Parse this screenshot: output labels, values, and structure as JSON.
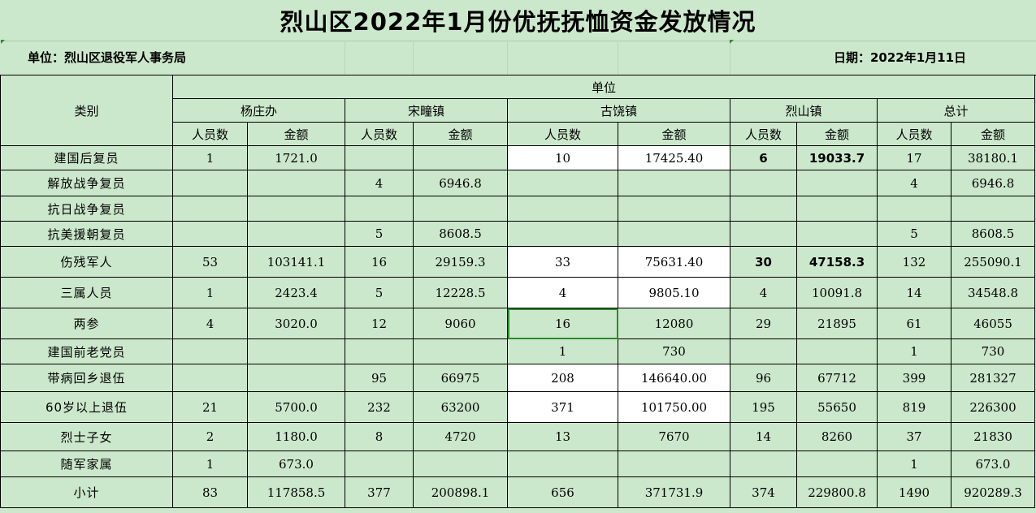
{
  "title": "烈山区2022年1月份优抚抚恤资金发放情况",
  "unit_label": "单位：烈山区退役军人事务局",
  "date_label": "日期：2022年1月11日",
  "header": {
    "category": "类别",
    "unit": "单位",
    "groups": [
      "杨庄办",
      "宋疃镇",
      "古饶镇",
      "烈山镇",
      "总计"
    ],
    "sub": [
      "人员数",
      "金额"
    ]
  },
  "rows": [
    {
      "label": "建国后复员",
      "vals": [
        "1",
        "1721.0",
        "",
        "",
        "10",
        "17425.40",
        "6",
        "19033.7",
        "17",
        "38180.1"
      ]
    },
    {
      "label": "解放战争复员",
      "vals": [
        "",
        "",
        "4",
        "6946.8",
        "",
        "",
        "",
        "",
        "4",
        "6946.8"
      ]
    },
    {
      "label": "抗日战争复员",
      "vals": [
        "",
        "",
        "",
        "",
        "",
        "",
        "",
        "",
        "",
        ""
      ]
    },
    {
      "label": "抗美援朝复员",
      "vals": [
        "",
        "",
        "5",
        "8608.5",
        "",
        "",
        "",
        "",
        "5",
        "8608.5"
      ]
    },
    {
      "label": "伤残军人",
      "vals": [
        "53",
        "103141.1",
        "16",
        "29159.3",
        "33",
        "75631.40",
        "30",
        "47158.3",
        "132",
        "255090.1"
      ]
    },
    {
      "label": "三属人员",
      "vals": [
        "1",
        "2423.4",
        "5",
        "12228.5",
        "4",
        "9805.10",
        "4",
        "10091.8",
        "14",
        "34548.8"
      ]
    },
    {
      "label": "两参",
      "vals": [
        "4",
        "3020.0",
        "12",
        "9060",
        "16",
        "12080",
        "29",
        "21895",
        "61",
        "46055"
      ]
    },
    {
      "label": "建国前老党员",
      "vals": [
        "",
        "",
        "",
        "",
        "1",
        "730",
        "",
        "",
        "1",
        "730"
      ]
    },
    {
      "label": "带病回乡退伍",
      "vals": [
        "",
        "",
        "95",
        "66975",
        "208",
        "146640.00",
        "96",
        "67712",
        "399",
        "281327"
      ]
    },
    {
      "label": "60岁以上退伍",
      "vals": [
        "21",
        "5700.0",
        "232",
        "63200",
        "371",
        "101750.00",
        "195",
        "55650",
        "819",
        "226300"
      ]
    },
    {
      "label": "烈士子女",
      "vals": [
        "2",
        "1180.0",
        "8",
        "4720",
        "13",
        "7670",
        "14",
        "8260",
        "37",
        "21830"
      ]
    },
    {
      "label": "随军家属",
      "vals": [
        "1",
        "673.0",
        "",
        "",
        "",
        "",
        "",
        "",
        "1",
        "673.0"
      ]
    },
    {
      "label": "小计",
      "vals": [
        "83",
        "117858.5",
        "377",
        "200898.1",
        "656",
        "371731.9",
        "374",
        "229800.8",
        "1490",
        "920289.3"
      ]
    }
  ],
  "highlight": {
    "white_cells_cols": [
      4,
      5
    ],
    "white_rows": [
      0,
      4,
      5,
      8,
      9
    ],
    "bold_rows": [
      0,
      4
    ],
    "bold_cols": [
      6,
      7
    ],
    "selected_cell": [
      6,
      4
    ]
  },
  "colors": {
    "sheet_bg": "#cce8cc",
    "highlight_bg": "#ffffff",
    "selection": "#2e8b2e"
  }
}
